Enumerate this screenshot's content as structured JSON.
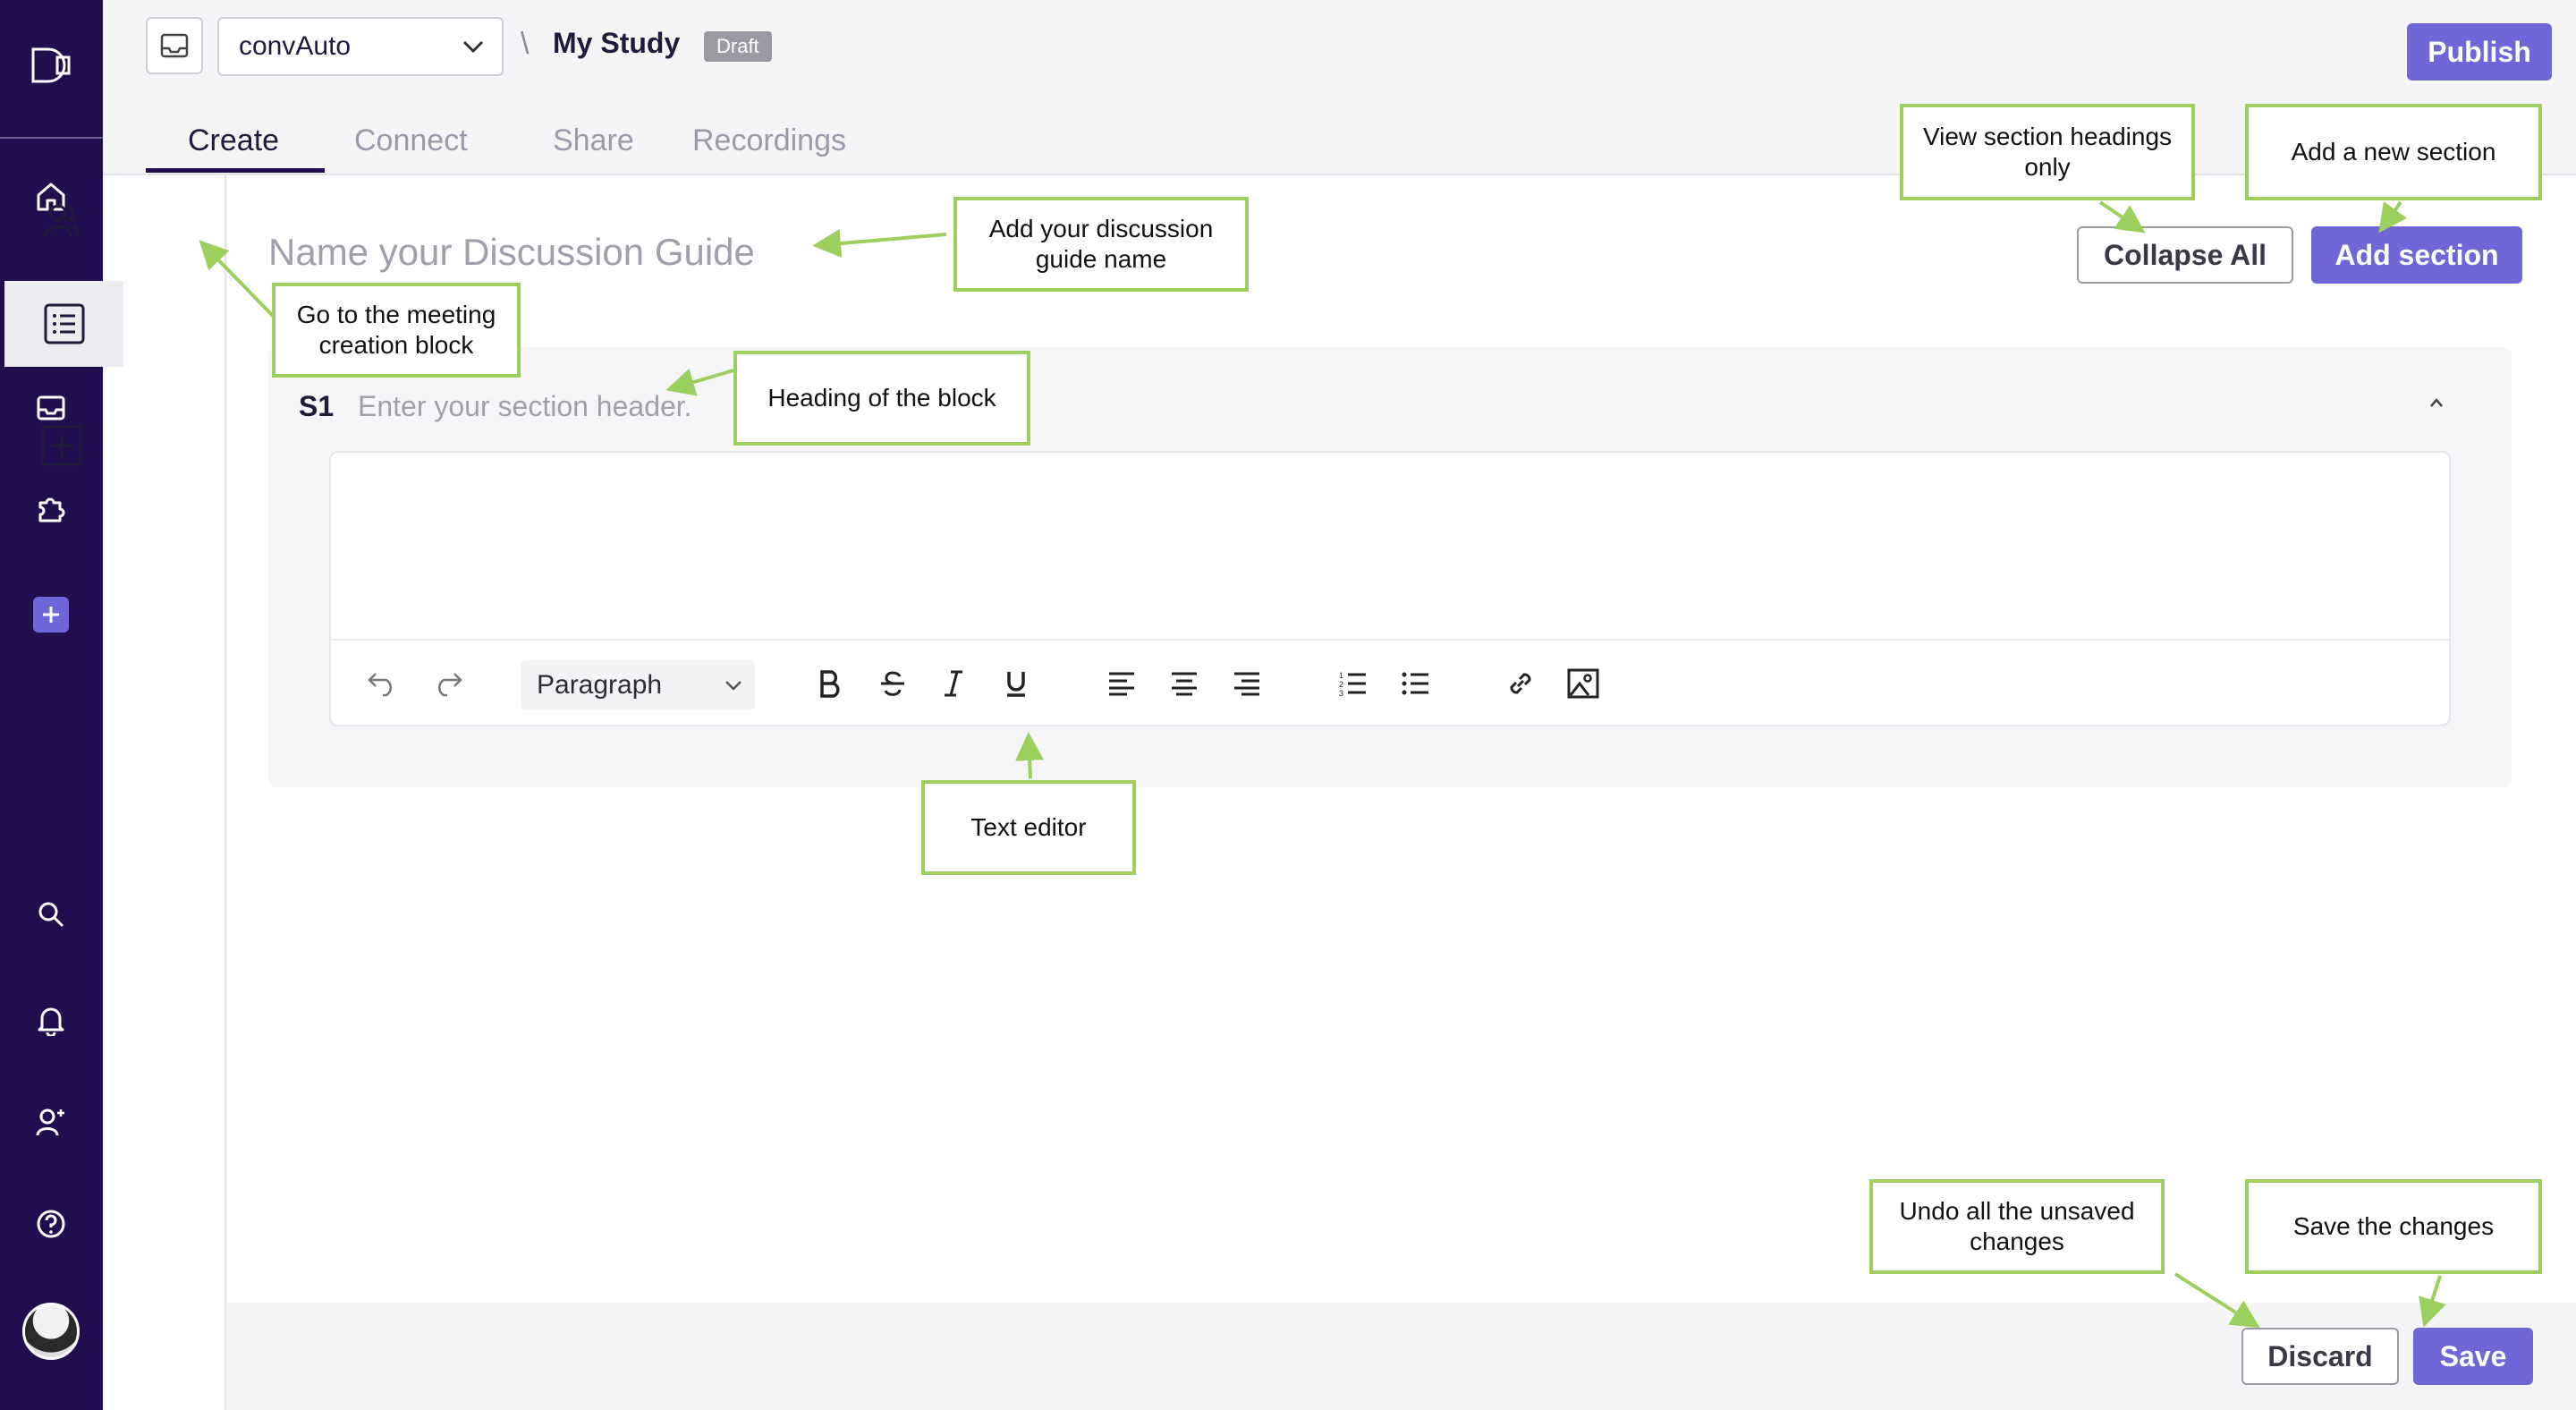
{
  "header": {
    "project_select": "convAuto",
    "crumb_separator": "\\",
    "study_name": "My Study",
    "status_badge": "Draft",
    "publish_label": "Publish"
  },
  "tabs": [
    {
      "label": "Create",
      "active": true
    },
    {
      "label": "Connect",
      "active": false
    },
    {
      "label": "Share",
      "active": false
    },
    {
      "label": "Recordings",
      "active": false
    }
  ],
  "rail": {
    "icons": [
      "logo-icon",
      "home-icon",
      "participants-icon",
      "inbox-icon",
      "integrations-icon",
      "add-icon",
      "search-icon",
      "notifications-icon",
      "invite-user-icon",
      "help-icon",
      "avatar"
    ]
  },
  "subsidebar": {
    "icons": [
      "participants-icon",
      "list-icon",
      "add-block-icon"
    ]
  },
  "main": {
    "guide_name_placeholder": "Name your Discussion Guide",
    "collapse_all_label": "Collapse All",
    "add_section_label": "Add section",
    "section": {
      "index": "S1",
      "header_placeholder": "Enter your section header."
    },
    "editor": {
      "paragraph_select": "Paragraph",
      "toolbar_icons": [
        "undo-icon",
        "redo-icon",
        "bold-icon",
        "strikethrough-icon",
        "italic-icon",
        "underline-icon",
        "align-left-icon",
        "align-center-icon",
        "align-right-icon",
        "ordered-list-icon",
        "bullet-list-icon",
        "link-icon",
        "image-icon"
      ]
    }
  },
  "footer": {
    "discard_label": "Discard",
    "save_label": "Save"
  },
  "callouts": {
    "guide_name": "Add your discussion guide name",
    "meeting_block": "Go to the meeting creation block",
    "block_heading": "Heading of the block",
    "text_editor": "Text editor",
    "collapse_all": "View section headings only",
    "add_section": "Add a new section",
    "discard": "Undo all the unsaved changes",
    "save": "Save the changes"
  },
  "colors": {
    "rail": "#200e4e",
    "accent": "#6f66d8",
    "callout_border": "#9bcf5e"
  }
}
